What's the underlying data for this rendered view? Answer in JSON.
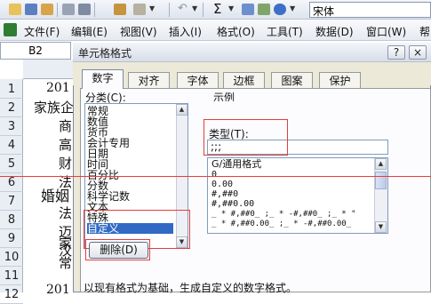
{
  "toolbar": {
    "font_name": "宋体",
    "autosum_symbol": "Σ"
  },
  "menu": {
    "items": [
      "文件(F)",
      "编辑(E)",
      "视图(V)",
      "插入(I)",
      "格式(O)",
      "工具(T)",
      "数据(D)",
      "窗口(W)",
      "帮"
    ]
  },
  "namebox": {
    "value": "B2"
  },
  "sheet": {
    "row_numbers": [
      "1",
      "2",
      "3",
      "4",
      "5",
      "6",
      "7",
      "8",
      "9",
      "10",
      "11",
      "12"
    ],
    "cells": [
      "201",
      "家族企",
      "商",
      "高",
      "财",
      "法",
      "婚姻",
      "法",
      "迈",
      "汉",
      "家",
      "常",
      "201"
    ]
  },
  "dialog": {
    "title": "单元格格式",
    "help_label": "?",
    "close_label": "×",
    "tabs": [
      "数字",
      "对齐",
      "字体",
      "边框",
      "图案",
      "保护"
    ],
    "active_tab": "数字",
    "category_label": "分类(C):",
    "categories": [
      "常规",
      "数值",
      "货币",
      "会计专用",
      "日期",
      "时间",
      "百分比",
      "分数",
      "科学记数",
      "文本",
      "特殊",
      "自定义"
    ],
    "selected_category": "自定义",
    "sample_label": "示例",
    "type_label": "类型(T):",
    "type_value": ";;;",
    "format_list": [
      "G/通用格式",
      "0",
      "0.00",
      "#,##0",
      "#,##0.00",
      "_ * #,##0_ ;_ * -#,##0_ ;_ * \"",
      "_ * #,##0.00_ ;_ * -#,##0.00_"
    ],
    "delete_button": "删除(D)",
    "description": "以现有格式为基础，生成自定义的数字格式。"
  },
  "colors": {
    "selection": "#316ac5",
    "annotation_red": "#e43d3d",
    "dialog_bg": "#ece9d8"
  }
}
